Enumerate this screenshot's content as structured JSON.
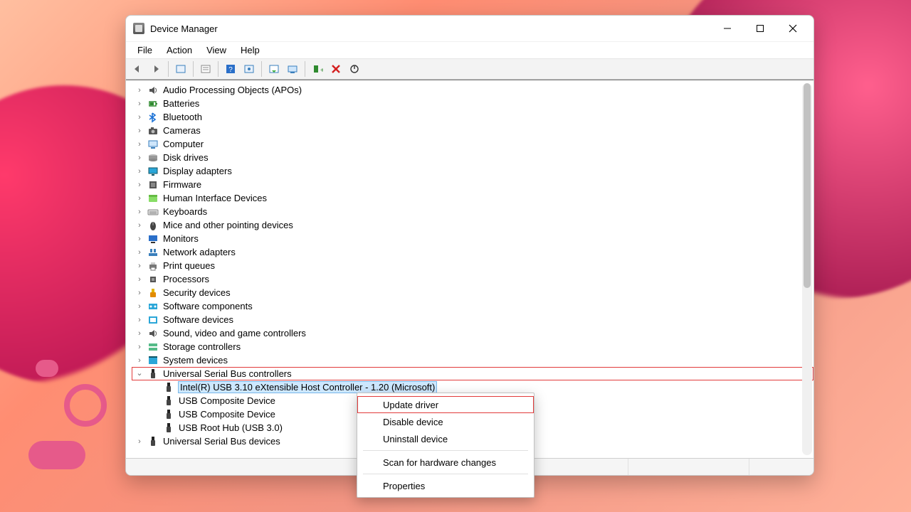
{
  "window": {
    "title": "Device Manager"
  },
  "menu": {
    "file": "File",
    "action": "Action",
    "view": "View",
    "help": "Help"
  },
  "toolbar_icons": [
    "back",
    "forward",
    "show-all",
    "properties",
    "help",
    "update",
    "scan",
    "monitor",
    "add-legacy",
    "remove",
    "enable"
  ],
  "tree": [
    {
      "label": "Audio Processing Objects (APOs)",
      "icon": "speaker"
    },
    {
      "label": "Batteries",
      "icon": "battery"
    },
    {
      "label": "Bluetooth",
      "icon": "bluetooth"
    },
    {
      "label": "Cameras",
      "icon": "camera"
    },
    {
      "label": "Computer",
      "icon": "computer"
    },
    {
      "label": "Disk drives",
      "icon": "disk"
    },
    {
      "label": "Display adapters",
      "icon": "display"
    },
    {
      "label": "Firmware",
      "icon": "firmware"
    },
    {
      "label": "Human Interface Devices",
      "icon": "hid"
    },
    {
      "label": "Keyboards",
      "icon": "keyboard"
    },
    {
      "label": "Mice and other pointing devices",
      "icon": "mouse"
    },
    {
      "label": "Monitors",
      "icon": "monitor"
    },
    {
      "label": "Network adapters",
      "icon": "network"
    },
    {
      "label": "Print queues",
      "icon": "printer"
    },
    {
      "label": "Processors",
      "icon": "cpu"
    },
    {
      "label": "Security devices",
      "icon": "security"
    },
    {
      "label": "Software components",
      "icon": "component"
    },
    {
      "label": "Software devices",
      "icon": "softdev"
    },
    {
      "label": "Sound, video and game controllers",
      "icon": "speaker"
    },
    {
      "label": "Storage controllers",
      "icon": "storage"
    },
    {
      "label": "System devices",
      "icon": "system"
    },
    {
      "label": "Universal Serial Bus controllers",
      "icon": "usb",
      "expanded": true,
      "highlighted": true,
      "children": [
        {
          "label": "Intel(R) USB 3.10 eXtensible Host Controller - 1.20 (Microsoft)",
          "icon": "usb",
          "selected": true
        },
        {
          "label": "USB Composite Device",
          "icon": "usb"
        },
        {
          "label": "USB Composite Device",
          "icon": "usb"
        },
        {
          "label": "USB Root Hub (USB 3.0)",
          "icon": "usb"
        }
      ]
    },
    {
      "label": "Universal Serial Bus devices",
      "icon": "usb"
    }
  ],
  "context_menu": {
    "items": [
      {
        "label": "Update driver",
        "highlight": true
      },
      {
        "label": "Disable device"
      },
      {
        "label": "Uninstall device"
      },
      {
        "sep": true
      },
      {
        "label": "Scan for hardware changes"
      },
      {
        "sep": true
      },
      {
        "label": "Properties"
      }
    ]
  }
}
